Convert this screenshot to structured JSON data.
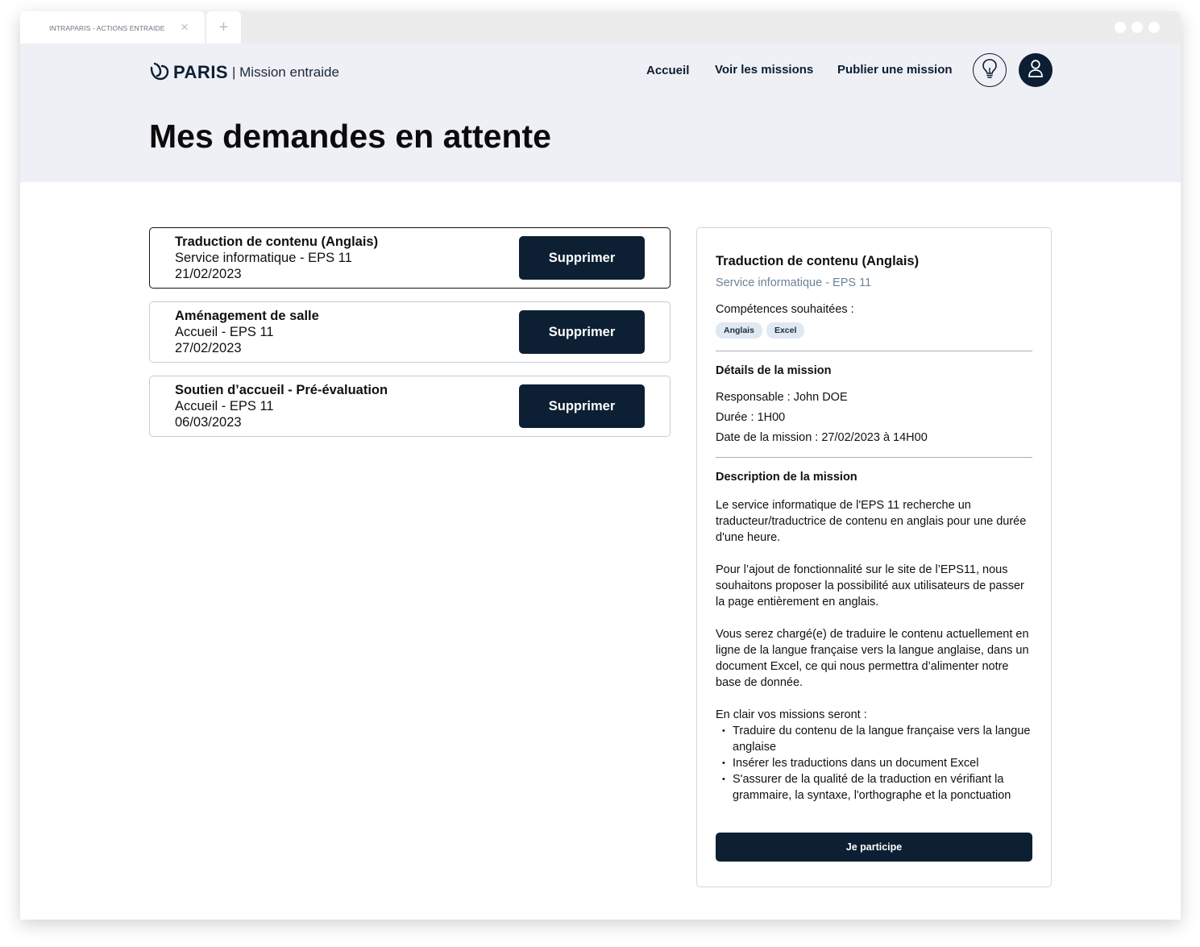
{
  "browser": {
    "tab_title": "INTRAPARIS - ACTIONS ENTRAIDE",
    "tab_close": "×",
    "new_tab": "+"
  },
  "header": {
    "logo_word": "PARIS",
    "logo_sub": "| Mission entraide",
    "nav": [
      "Accueil",
      "Voir les missions",
      "Publier une mission"
    ],
    "lightbulb_icon": "lightbulb-icon",
    "user_icon": "user-icon"
  },
  "page": {
    "title": "Mes demandes en attente"
  },
  "requests": [
    {
      "title": "Traduction de contenu (Anglais)",
      "service": "Service informatique - EPS 11",
      "date": "21/02/2023",
      "button": "Supprimer",
      "selected": true
    },
    {
      "title": "Aménagement de salle",
      "service": "Accueil - EPS 11",
      "date": "27/02/2023",
      "button": "Supprimer",
      "selected": false
    },
    {
      "title": "Soutien d’accueil - Pré-évaluation",
      "service": "Accueil - EPS 11",
      "date": "06/03/2023",
      "button": "Supprimer",
      "selected": false
    }
  ],
  "detail": {
    "title": "Traduction de contenu (Anglais)",
    "service": "Service informatique - EPS 11",
    "skills_label": "Compétences souhaitées :",
    "skills": [
      "Anglais",
      "Excel"
    ],
    "details_heading": "Détails de la mission",
    "responsable": "Responsable : John DOE",
    "duree": "Durée : 1H00",
    "date": "Date de la mission : 27/02/2023 à 14H00",
    "description_heading": "Description de la mission",
    "paragraphs": [
      "Le service informatique de l'EPS 11 recherche un traducteur/traductrice de contenu en anglais pour une durée d'une heure.",
      "Pour l’ajout de fonctionnalité sur le site de l’EPS11, nous souhaitons proposer la possibilité aux utilisateurs de passer la page entièrement en anglais.",
      "Vous serez chargé(e) de traduire le contenu actuellement en ligne de la langue française vers la langue anglaise, dans un document Excel, ce qui nous permettra d’alimenter notre base de donnée."
    ],
    "list_intro": "En clair vos missions seront :",
    "bullets": [
      "Traduire du contenu de la langue française vers la langue anglaise",
      "Insérer les traductions dans un document Excel",
      "S'assurer de la qualité de la traduction en vérifiant la grammaire, la syntaxe, l'orthographe et la ponctuation"
    ],
    "cta": "Je participe"
  },
  "colors": {
    "navy": "#0c1f33",
    "hero_bg": "#eff0f5",
    "chip_bg": "#e0e8f1",
    "muted_text": "#6c8397"
  }
}
